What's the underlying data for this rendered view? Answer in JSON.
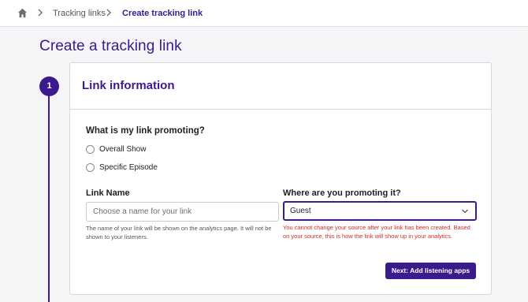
{
  "breadcrumb": {
    "home_icon": "home-icon",
    "items": [
      "Tracking links",
      "Create tracking link"
    ]
  },
  "page": {
    "title": "Create a tracking link"
  },
  "stepper": {
    "current_step": "1"
  },
  "section": {
    "title": "Link information",
    "question": "What is my link promoting?",
    "options": [
      "Overall Show",
      "Specific Episode"
    ]
  },
  "link_name": {
    "label": "Link Name",
    "placeholder": "Choose a name for your link",
    "value": "",
    "helper": "The name of your link will be shown on the analytics page. It will not be shown to your listeners."
  },
  "source": {
    "label": "Where are you promoting it?",
    "selected": "Guest",
    "error": "You cannot change your source after your link has been created. Based on your source, this is how the link will show up in your analytics."
  },
  "actions": {
    "next_label": "Next: Add listening apps"
  },
  "colors": {
    "accent": "#3a1a8c",
    "error": "#d12a2a"
  }
}
